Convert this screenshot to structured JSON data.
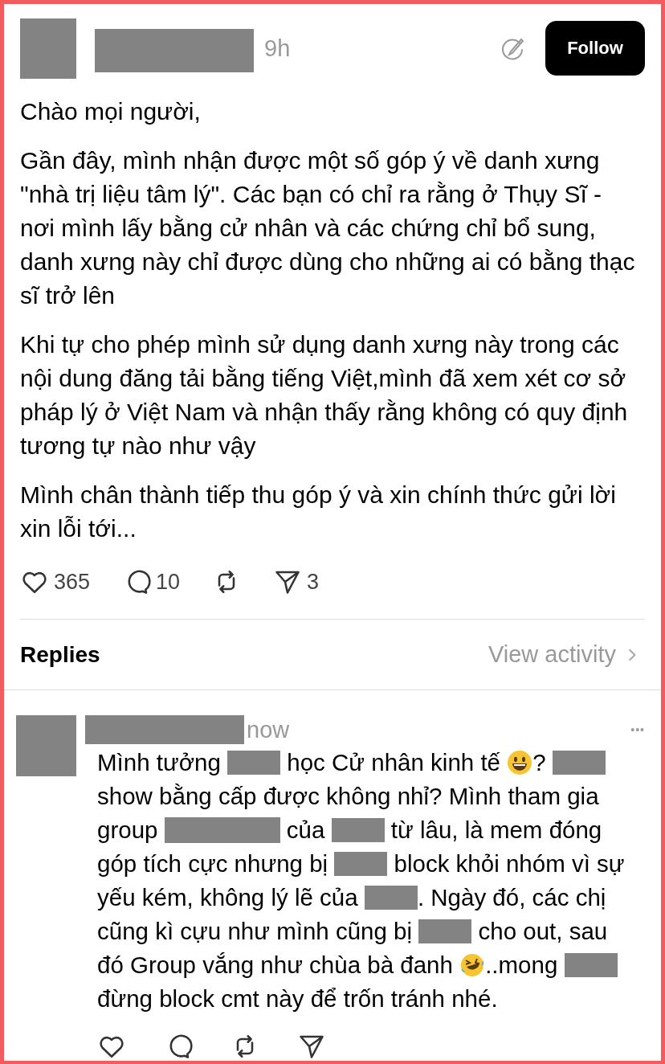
{
  "post": {
    "time": "9h",
    "follow_label": "Follow",
    "paragraphs": [
      {
        "lines": [
          "Chào mọi người,"
        ]
      },
      {
        "lines": [
          "Gần đây, mình nhận được một số góp ý về danh xưng",
          "\"nhà trị liệu tâm lý\". Các bạn có chỉ ra rằng ở Thụy Sĩ -",
          "nơi mình lấy bằng cử nhân và các chứng chỉ bổ sung,",
          "danh xưng này chỉ được dùng cho những ai có bằng thạc",
          "sĩ trở lên"
        ]
      },
      {
        "lines": [
          "Khi tự cho phép mình sử dụng danh xưng này trong các",
          "nội dung đăng tải bằng tiếng Việt,mình đã xem xét cơ sở",
          "pháp lý ở Việt Nam và nhận thấy rằng không có quy định",
          "tương tự nào như vậy"
        ]
      },
      {
        "lines": [
          "Mình chân thành tiếp thu góp ý và xin chính thức gửi lời",
          "xin lỗi tới..."
        ]
      }
    ],
    "actions": [
      {
        "kind": "like",
        "count": "365"
      },
      {
        "kind": "comment",
        "count": "10"
      },
      {
        "kind": "repost"
      },
      {
        "kind": "share",
        "count": "3"
      }
    ]
  },
  "replies_header": {
    "title": "Replies",
    "link": "View activity"
  },
  "reply": {
    "time": "now",
    "more": "•••",
    "lines": [
      [
        {
          "kind": "text",
          "text": "Mình tưởng "
        },
        {
          "kind": "redacted"
        },
        {
          "kind": "text",
          "text": " học Cử nhân kinh tế "
        },
        {
          "kind": "smile"
        },
        {
          "kind": "text",
          "text": "? "
        },
        {
          "kind": "redacted"
        }
      ],
      [
        {
          "kind": "text",
          "text": "show bằng cấp được không nhỉ? Mình tham gia"
        }
      ],
      [
        {
          "kind": "text",
          "text": "group "
        },
        {
          "kind": "redacted_long"
        },
        {
          "kind": "text",
          "text": " của "
        },
        {
          "kind": "redacted"
        },
        {
          "kind": "text",
          "text": " từ lâu, là mem đóng"
        }
      ],
      [
        {
          "kind": "text",
          "text": "góp tích cực nhưng bị "
        },
        {
          "kind": "redacted"
        },
        {
          "kind": "text",
          "text": " block khỏi nhóm vì sự"
        }
      ],
      [
        {
          "kind": "text",
          "text": "yếu kém, không lý lẽ của "
        },
        {
          "kind": "redacted"
        },
        {
          "kind": "text",
          "text": ". Ngày đó, các chị"
        }
      ],
      [
        {
          "kind": "text",
          "text": "cũng kì cựu như mình cũng bị "
        },
        {
          "kind": "redacted"
        },
        {
          "kind": "text",
          "text": " cho out, sau"
        }
      ],
      [
        {
          "kind": "text",
          "text": "đó Group vắng như chùa bà đanh "
        },
        {
          "kind": "laugh"
        },
        {
          "kind": "text",
          "text": "..mong "
        },
        {
          "kind": "redacted"
        }
      ],
      [
        {
          "kind": "text",
          "text": "đừng block cmt này để trốn tránh nhé."
        }
      ]
    ],
    "actions": [
      {
        "kind": "like"
      },
      {
        "kind": "comment"
      },
      {
        "kind": "repost"
      },
      {
        "kind": "share"
      }
    ]
  }
}
